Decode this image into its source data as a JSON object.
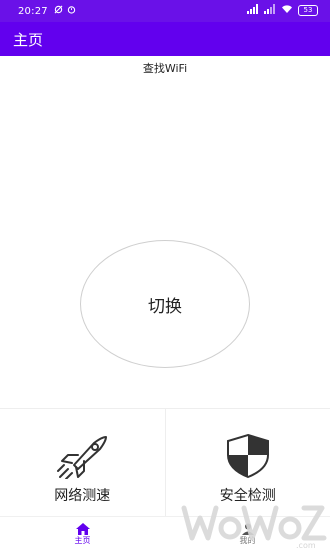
{
  "status_bar": {
    "time": "20:27",
    "battery": "53",
    "icons": [
      "sync-icon",
      "alarm-icon",
      "signal-icon",
      "signal-icon",
      "wifi-icon",
      "battery-icon"
    ]
  },
  "app_bar": {
    "title": "主页"
  },
  "main": {
    "find_wifi_label": "查找WiFi",
    "switch_label": "切换",
    "features": [
      {
        "label": "网络测速",
        "icon": "rocket-icon"
      },
      {
        "label": "安全检测",
        "icon": "shield-icon"
      }
    ]
  },
  "bottom_nav": {
    "items": [
      {
        "label": "主页",
        "icon": "home-icon",
        "active": true
      },
      {
        "label": "我的",
        "icon": "person-icon",
        "active": false
      }
    ]
  },
  "watermark": {
    "text": "WoWoZ.com"
  },
  "colors": {
    "primary": "#6200ee",
    "status_bar": "#6a11e8"
  }
}
